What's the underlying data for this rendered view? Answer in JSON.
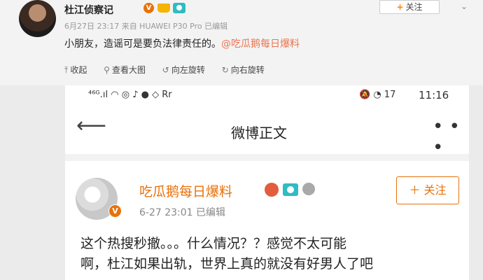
{
  "header": {
    "user_name": "杜江侦察记",
    "verified_badge": "V",
    "meta": "6月27日 23:17 来自 HUAWEI P30 Pro   已编辑",
    "follow_label": "关注",
    "follow_plus": "+",
    "chevron": "⌄"
  },
  "post": {
    "text": "小朋友，造谣可是要负法律责任的。",
    "mention": "@吃瓜鹅每日爆料"
  },
  "toolbar": {
    "collapse": "收起",
    "view_large": "查看大图",
    "rotate_left": "向左旋转",
    "rotate_right": "向右旋转"
  },
  "screenshot": {
    "status_left": "⁴⁶ᴳ.ıl  ◠  ◎  ♪  ●  ◇  Rr",
    "status_right": "🔕  ◔  17",
    "time": "11:16",
    "nav_back": "⟵",
    "nav_title": "微博正文",
    "nav_more": "• • •",
    "author": "吃瓜鹅每日爆料",
    "verified": "V",
    "meta": "6-27 23:01   已编辑",
    "follow_label": "＋ 关注",
    "text_line1": "这个热搜秒撤。。。什么情况？？感觉不太可能",
    "text_line2": "啊，杜江如果出轨，世界上真的就没有好男人了吧"
  },
  "colors": {
    "accent": "#e8710a",
    "mention": "#eb7350",
    "camera": "#2fbcc2"
  }
}
